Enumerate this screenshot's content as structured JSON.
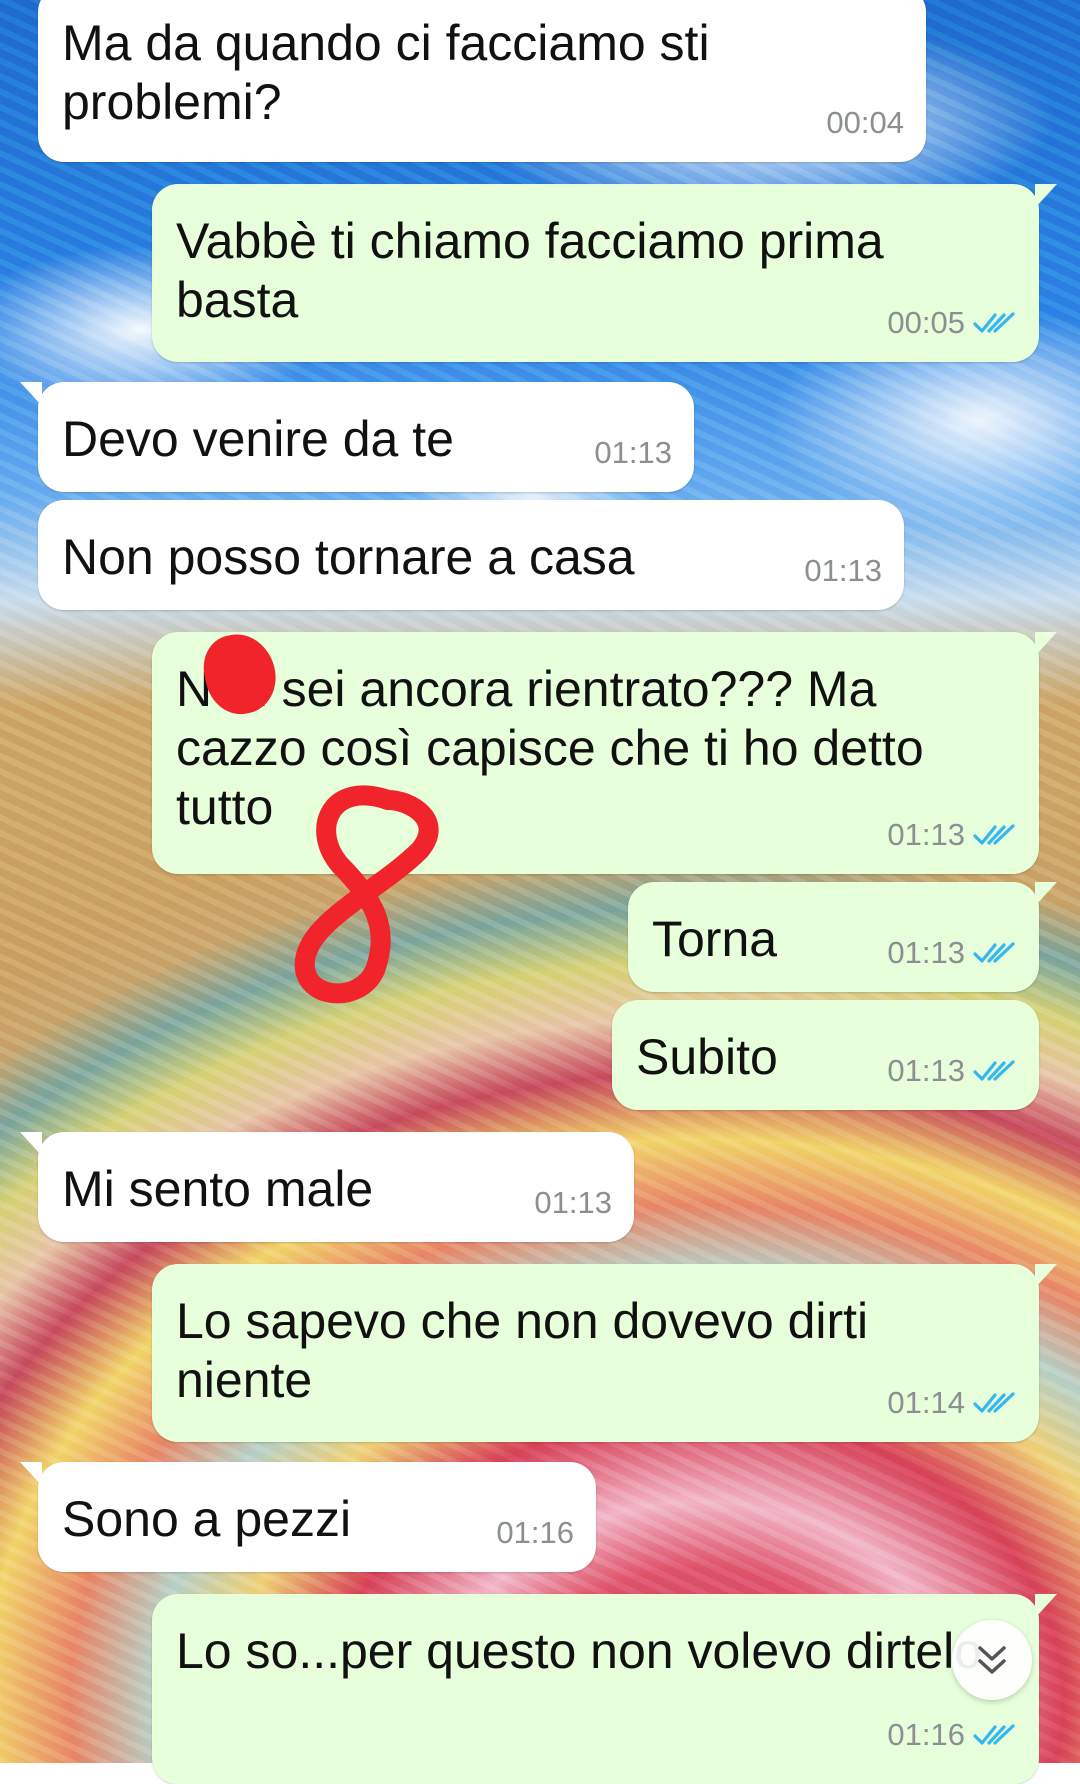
{
  "messages": [
    {
      "id": "m1",
      "direction": "in",
      "text": "Ma da quando ci facciamo sti problemi?",
      "time": "00:04"
    },
    {
      "id": "m2",
      "direction": "out",
      "text": "Vabbè ti chiamo facciamo prima basta",
      "time": "00:05",
      "status": "read"
    },
    {
      "id": "m3",
      "direction": "in",
      "text": "Devo venire da te",
      "time": "01:13"
    },
    {
      "id": "m4",
      "direction": "in",
      "text": "Non posso tornare a casa",
      "time": "01:13"
    },
    {
      "id": "m5",
      "direction": "out",
      "text": "Non sei ancora rientrato??? Ma cazzo così capisce che ti ho detto tutto",
      "time": "01:13",
      "status": "read"
    },
    {
      "id": "m6",
      "direction": "out",
      "text": "Torna",
      "time": "01:13",
      "status": "read"
    },
    {
      "id": "m7",
      "direction": "out",
      "text": "Subito",
      "time": "01:13",
      "status": "read"
    },
    {
      "id": "m8",
      "direction": "in",
      "text": "Mi sento male",
      "time": "01:13"
    },
    {
      "id": "m9",
      "direction": "out",
      "text": "Lo sapevo che non dovevo dirti niente",
      "time": "01:14",
      "status": "read"
    },
    {
      "id": "m10",
      "direction": "in",
      "text": "Sono a pezzi",
      "time": "01:16"
    },
    {
      "id": "m11",
      "direction": "out",
      "text": "Lo so...per questo non volevo dirtelo",
      "time": "01:16",
      "status": "read"
    }
  ],
  "colors": {
    "incoming_bubble": "#ffffff",
    "outgoing_bubble": "#e7ffdb",
    "read_ticks": "#34b7f1",
    "timestamp": "#8b8f91",
    "annotation_red": "#f0242a"
  },
  "icons": {
    "read_receipt": "double-check-icon",
    "scroll_down": "double-chevron-down-icon"
  }
}
